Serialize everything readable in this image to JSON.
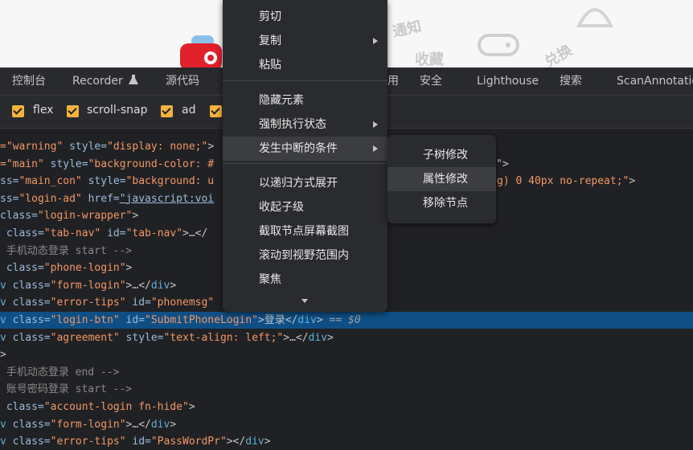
{
  "webpage": {
    "deco_texts": [
      "通知",
      "收藏",
      "兑换"
    ]
  },
  "devtools_tabs": [
    "控制台",
    "Recorder",
    "源代码",
    "用",
    "安全",
    "Lighthouse",
    "搜索",
    "ScanAnnotatio"
  ],
  "filters": [
    {
      "label": "flex",
      "checked": true
    },
    {
      "label": "scroll-snap",
      "checked": true
    },
    {
      "label": "ad",
      "checked": true
    },
    {
      "label": "",
      "checked": true
    }
  ],
  "code_lines": [
    {
      "parts": [
        [
          "v",
          "=\"warning\""
        ],
        [
          "a",
          " style="
        ],
        [
          "v",
          "\"display: none;\""
        ],
        [
          "x",
          ">"
        ]
      ]
    },
    {
      "parts": [
        [
          "v",
          "=\"main\""
        ],
        [
          "a",
          " style="
        ],
        [
          "v",
          "\"background-color: #"
        ]
      ],
      "tail": [
        [
          "x",
          "\">"
        ]
      ]
    },
    {
      "parts": [
        [
          "a",
          "ss="
        ],
        [
          "v",
          "\"main_con\""
        ],
        [
          "a",
          " style="
        ],
        [
          "v",
          "\"background: u"
        ]
      ],
      "tail": [
        [
          "v",
          "g) 0 40px no-repeat;\""
        ],
        [
          "x",
          ">"
        ]
      ]
    },
    {
      "parts": [
        [
          "a",
          "ss="
        ],
        [
          "v",
          "\"login-ad\""
        ],
        [
          "a",
          " href="
        ],
        [
          "lnk",
          "\"javascript:voi"
        ]
      ]
    },
    {
      "parts": [
        [
          "a",
          "class="
        ],
        [
          "v",
          "\"login-wrapper\""
        ],
        [
          "x",
          ">"
        ]
      ]
    },
    {
      "parts": [
        [
          "a",
          " class="
        ],
        [
          "v",
          "\"tab-nav\""
        ],
        [
          "a",
          " id="
        ],
        [
          "v",
          "\"tab-nav\""
        ],
        [
          "x",
          ">…</"
        ]
      ]
    },
    {
      "parts": [
        [
          "c",
          " 手机动态登录 start -->"
        ]
      ]
    },
    {
      "parts": [
        [
          "a",
          " class="
        ],
        [
          "v",
          "\"phone-login\""
        ],
        [
          "x",
          ">"
        ]
      ]
    },
    {
      "parts": [
        [
          "t",
          "v"
        ],
        [
          "a",
          " class="
        ],
        [
          "v",
          "\"form-login\""
        ],
        [
          "x",
          ">…</"
        ],
        [
          "t",
          "div"
        ],
        [
          "x",
          ">"
        ]
      ]
    },
    {
      "parts": [
        [
          "t",
          "v"
        ],
        [
          "a",
          " class="
        ],
        [
          "v",
          "\"error-tips\""
        ],
        [
          "a",
          " id="
        ],
        [
          "v",
          "\"phonemsg\""
        ]
      ]
    },
    {
      "parts": [
        [
          "t",
          "v"
        ],
        [
          "a",
          " class="
        ],
        [
          "v",
          "\"login-btn\""
        ],
        [
          "a",
          " id="
        ],
        [
          "v",
          "\"SubmitPhoneLogin\""
        ],
        [
          "x",
          ">登录</"
        ],
        [
          "t",
          "div"
        ],
        [
          "x",
          ">"
        ],
        [
          "eq",
          " == $0"
        ]
      ],
      "selected": true
    },
    {
      "parts": [
        [
          "t",
          "v"
        ],
        [
          "a",
          " class="
        ],
        [
          "v",
          "\"agreement\""
        ],
        [
          "a",
          " style="
        ],
        [
          "v",
          "\"text-align: left;\""
        ],
        [
          "x",
          ">…</"
        ],
        [
          "t",
          "div"
        ],
        [
          "x",
          ">"
        ]
      ]
    },
    {
      "parts": [
        [
          "x",
          ">"
        ]
      ]
    },
    {
      "parts": [
        [
          "c",
          " 手机动态登录 end -->"
        ]
      ]
    },
    {
      "parts": [
        [
          "c",
          " 账号密码登录 start -->"
        ]
      ]
    },
    {
      "parts": [
        [
          "a",
          " class="
        ],
        [
          "v",
          "\"account-login fn-hide\""
        ],
        [
          "x",
          ">"
        ]
      ]
    },
    {
      "parts": [
        [
          "t",
          "v"
        ],
        [
          "a",
          " class="
        ],
        [
          "v",
          "\"form-login\""
        ],
        [
          "x",
          ">…</"
        ],
        [
          "t",
          "div"
        ],
        [
          "x",
          ">"
        ]
      ]
    },
    {
      "parts": [
        [
          "t",
          "v"
        ],
        [
          "a",
          " class="
        ],
        [
          "v",
          "\"error-tips\""
        ],
        [
          "a",
          " id="
        ],
        [
          "v",
          "\"PassWordPr\""
        ],
        [
          "x",
          "></"
        ],
        [
          "t",
          "div"
        ],
        [
          "x",
          ">"
        ]
      ]
    }
  ],
  "context_menu": {
    "items": [
      {
        "label": "剪切"
      },
      {
        "label": "复制",
        "submenu": true
      },
      {
        "label": "粘贴"
      },
      {
        "label": "隐藏元素"
      },
      {
        "label": "强制执行状态",
        "submenu": true
      },
      {
        "label": "发生中断的条件",
        "submenu": true,
        "highlighted": true
      },
      {
        "label": "以递归方式展开"
      },
      {
        "label": "收起子级"
      },
      {
        "label": "截取节点屏幕截图"
      },
      {
        "label": "滚动到视野范围内"
      },
      {
        "label": "聚焦"
      }
    ]
  },
  "submenu": {
    "items": [
      {
        "label": "子树修改"
      },
      {
        "label": "属性修改",
        "highlighted": true
      },
      {
        "label": "移除节点"
      }
    ]
  },
  "colors": {
    "selection": "#0f4f86",
    "checkbox": "#f3b33d",
    "menu_bg": "#2a2b2e"
  }
}
